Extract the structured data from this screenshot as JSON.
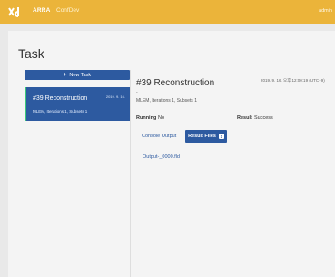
{
  "topbar": {
    "brand": "ARRA",
    "brand_sub": "ConfDev",
    "user": "admin"
  },
  "page": {
    "title": "Task"
  },
  "sidebar": {
    "new_task_label": "New Task",
    "tasks": [
      {
        "title": "#39 Reconstruction",
        "date": "2019. 9. 16.",
        "subtitle": "MLEM, Iterations 1, Subsets 1"
      }
    ]
  },
  "detail": {
    "title": "#39 Reconstruction",
    "date": "2019. 9. 16. 오후 12:00:19 (UTC+9)",
    "dash": "-",
    "params": "MLEM, Iterations 1, Subsets 1",
    "running_label": "Running",
    "running_value": "No",
    "result_label": "Result",
    "result_value": "Success",
    "tabs": {
      "console": "Console Output",
      "files": "Result Files",
      "files_count": "1"
    },
    "files": [
      "Output-_0000.fld"
    ]
  },
  "colors": {
    "topbar": "#ebb43a",
    "primary": "#2d5aa0",
    "accent_green": "#3ac87a"
  }
}
